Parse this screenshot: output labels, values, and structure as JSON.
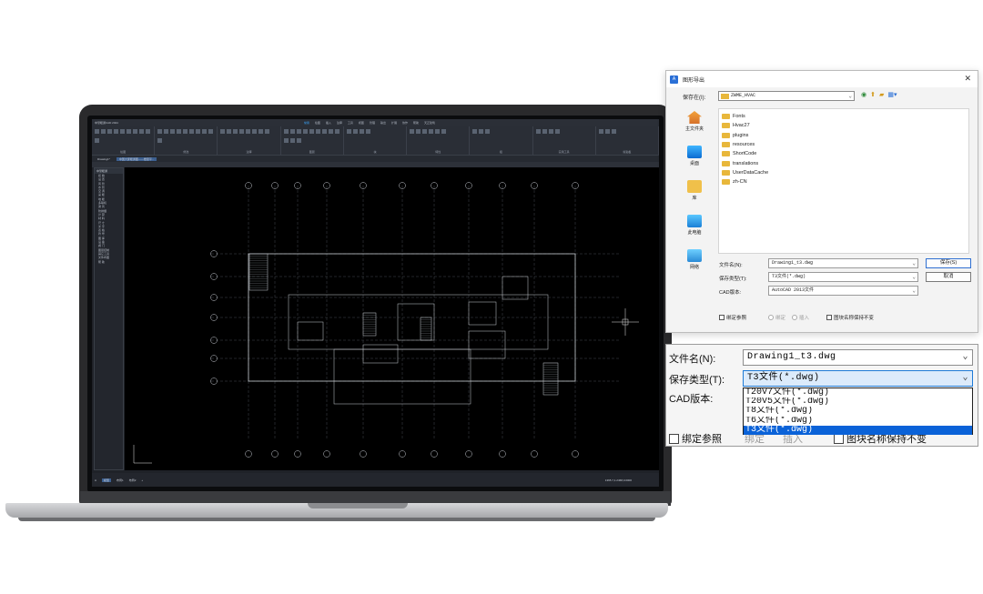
{
  "cad": {
    "app_title": "中望暖通CAD 2024",
    "menus": [
      "常用",
      "绘图",
      "插入",
      "注释",
      "工具",
      "视图",
      "管理",
      "输出",
      "扩展",
      "协作",
      "帮助",
      "天正建筑"
    ],
    "ribbon_groups": [
      "绘图",
      "修改",
      "注释",
      "图层",
      "块",
      "特性",
      "组",
      "实用工具",
      "剪贴板"
    ],
    "doc_tabs": [
      "Drawing1*",
      "中国大厦暖通图——楼层平..."
    ],
    "left_panel_title": "中望暖通",
    "left_panel_items": [
      "初 始",
      "设 置",
      "风 管",
      "水 管",
      "空 调",
      "采 暖",
      "地 暖",
      "多联机",
      "通 风",
      "防排烟",
      "计 算",
      "材 料",
      "尺 寸",
      "文 字",
      "表 格",
      "符 号",
      "图 库",
      "设 备",
      "阀 门",
      "图层控制",
      "其它工具",
      "文件布图",
      "帮 助"
    ],
    "status_tabs": [
      "模型",
      "布局1",
      "布局2"
    ],
    "coords": "1365.7,1.2468,0.0000"
  },
  "dialog": {
    "title": "图形导出",
    "close_icon": "close-icon",
    "save_in_label": "保存在(I):",
    "save_in_value": "ZWME_HVAC",
    "places": [
      {
        "label": "主文件夹",
        "icon": "home-icon"
      },
      {
        "label": "桌面",
        "icon": "desktop-icon"
      },
      {
        "label": "库",
        "icon": "folder-icon"
      },
      {
        "label": "此电脑",
        "icon": "computer-icon"
      },
      {
        "label": "网络",
        "icon": "network-icon"
      }
    ],
    "files": [
      "Fonts",
      "Hvac27",
      "plugins",
      "resources",
      "ShortCode",
      "translations",
      "UserDataCache",
      "zh-CN"
    ],
    "filename_label": "文件名(N):",
    "filename_value": "Drawing1_t3.dwg",
    "filetype_label": "保存类型(T):",
    "filetype_value": "T3文件(*.dwg)",
    "cad_version_label": "CAD版本:",
    "cad_version_value": "AutoCAD 2013文件",
    "save_button": "保存(S)",
    "cancel_button": "取消",
    "bind_ref_label": "绑定参照",
    "bind_label": "绑定",
    "insert_label": "插入",
    "keep_block_label": "图块名称保持不变"
  },
  "zoom": {
    "filename_label": "文件名(N):",
    "filename_value": "Drawing1_t3.dwg",
    "filetype_label": "保存类型(T):",
    "filetype_value": "T3文件(*.dwg)",
    "cad_version_label": "CAD版本:",
    "options": [
      "T20V7文件(*.dwg)",
      "T20V5文件(*.dwg)",
      "T8文件(*.dwg)",
      "T6文件(*.dwg)",
      "T3文件(*.dwg)"
    ],
    "selected_option": "T3文件(*.dwg)",
    "bind_ref_label": "绑定参照",
    "bind_label": "绑定",
    "insert_label": "插入",
    "keep_block_label": "图块名称保持不变"
  }
}
